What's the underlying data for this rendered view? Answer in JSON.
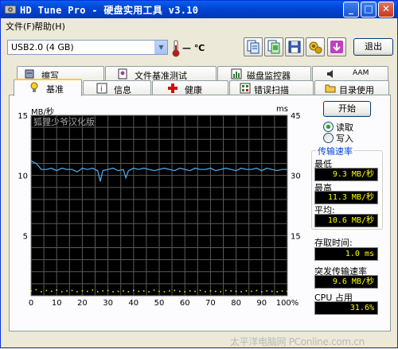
{
  "window": {
    "title": "HD Tune Pro - 硬盘实用工具 v3.10",
    "titlebar_buttons": [
      "minimize",
      "maximize",
      "close"
    ]
  },
  "menu": {
    "file": "文件(F)",
    "help": "帮助(H)"
  },
  "toolbar": {
    "drive": "USB2.0 (4 GB)",
    "temperature": "— ℃",
    "icons": [
      "copy-text-icon",
      "copy-screenshot-icon",
      "save-icon",
      "options-icon",
      "download-icon"
    ],
    "exit_label": "退出"
  },
  "tabs_back": [
    {
      "label": "擦写",
      "icon": "erase-icon"
    },
    {
      "label": "文件基准测试",
      "icon": "file-benchmark-icon"
    },
    {
      "label": "磁盘监控器",
      "icon": "disk-monitor-icon"
    },
    {
      "label": "AAM",
      "icon": "aam-icon"
    }
  ],
  "tabs_front": [
    {
      "label": "基准",
      "icon": "benchmark-icon",
      "active": true
    },
    {
      "label": "信息",
      "icon": "info-icon"
    },
    {
      "label": "健康",
      "icon": "health-icon"
    },
    {
      "label": "错误扫描",
      "icon": "error-scan-icon"
    },
    {
      "label": "目录使用",
      "icon": "folder-usage-icon"
    }
  ],
  "chart": {
    "left_unit": "MB/秒",
    "right_unit": "ms",
    "overlay_text": "狐狸少爷汉化版"
  },
  "chart_data": {
    "type": "line",
    "xlabel": "",
    "ylabel": "MB/秒",
    "y2label": "ms",
    "xlim": [
      0,
      100
    ],
    "ylim": [
      0,
      15
    ],
    "y2lim": [
      0,
      45
    ],
    "x_ticks": [
      "0",
      "10",
      "20",
      "30",
      "40",
      "50",
      "60",
      "70",
      "80",
      "90",
      "100%"
    ],
    "y_ticks": [
      "5",
      "10",
      "15"
    ],
    "y2_ticks": [
      "15",
      "30",
      "45"
    ],
    "grid": true,
    "background": "#000000",
    "series": [
      {
        "color": "#4FA3E0",
        "axis": "left",
        "x": [
          0,
          2,
          4,
          6,
          8,
          10,
          12,
          14,
          16,
          18,
          20,
          22,
          24,
          26,
          27,
          28,
          30,
          32,
          34,
          36,
          37,
          38,
          40,
          42,
          44,
          46,
          48,
          50,
          52,
          54,
          56,
          58,
          60,
          62,
          64,
          66,
          68,
          70,
          72,
          74,
          76,
          78,
          80,
          82,
          84,
          86,
          88,
          90,
          92,
          94,
          96,
          98,
          100
        ],
        "y": [
          11.2,
          11.0,
          10.5,
          10.5,
          10.6,
          10.4,
          10.6,
          10.5,
          10.5,
          10.3,
          10.6,
          10.5,
          10.6,
          10.4,
          9.5,
          10.4,
          10.5,
          10.6,
          10.4,
          10.5,
          9.8,
          10.4,
          10.6,
          10.5,
          10.6,
          10.5,
          10.4,
          10.5,
          10.6,
          10.5,
          10.4,
          10.6,
          10.5,
          10.4,
          10.6,
          10.5,
          10.5,
          10.6,
          10.4,
          10.5,
          10.6,
          10.5,
          10.4,
          10.6,
          10.5,
          10.5,
          10.6,
          10.4,
          10.6,
          10.5,
          10.4,
          10.5,
          10.5
        ]
      },
      {
        "color": "#E8E800",
        "axis": "right",
        "x": [
          0,
          2,
          4,
          6,
          8,
          10,
          12,
          14,
          16,
          18,
          20,
          22,
          24,
          26,
          28,
          30,
          32,
          34,
          36,
          38,
          40,
          42,
          44,
          46,
          48,
          50,
          52,
          54,
          56,
          58,
          60,
          62,
          64,
          66,
          68,
          70,
          72,
          74,
          76,
          78,
          80,
          82,
          84,
          86,
          88,
          90,
          92,
          94,
          96,
          98,
          100
        ],
        "y": [
          1.2,
          1.5,
          1.0,
          1.3,
          1.1,
          1.4,
          1.0,
          1.2,
          1.3,
          1.0,
          1.2,
          1.1,
          1.4,
          1.0,
          1.2,
          1.3,
          1.0,
          1.1,
          1.2,
          1.0,
          1.3,
          1.1,
          1.2,
          1.0,
          1.4,
          1.1,
          1.0,
          1.2,
          1.3,
          1.1,
          1.0,
          1.2,
          1.1,
          1.3,
          1.0,
          1.2,
          1.1,
          1.0,
          1.3,
          1.2,
          1.1,
          1.0,
          1.2,
          1.1,
          1.3,
          1.0,
          1.2,
          1.1,
          1.0,
          1.2,
          1.1
        ]
      }
    ]
  },
  "side": {
    "start_label": "开始",
    "read_label": "读取",
    "write_label": "写入",
    "transfer_rate_title": "传输速率",
    "min_label": "最低",
    "min_value": "9.3 MB/秒",
    "max_label": "最高",
    "max_value": "11.3 MB/秒",
    "avg_label": "平均:",
    "avg_value": "10.6 MB/秒",
    "access_label": "存取时间:",
    "access_value": "1.0 ms",
    "burst_label": "突发传输速率",
    "burst_value": "9.6 MB/秒",
    "cpu_label": "CPU 占用",
    "cpu_value": "31.6%"
  },
  "watermark": "太平洋电脑网 PConline.com.cn"
}
